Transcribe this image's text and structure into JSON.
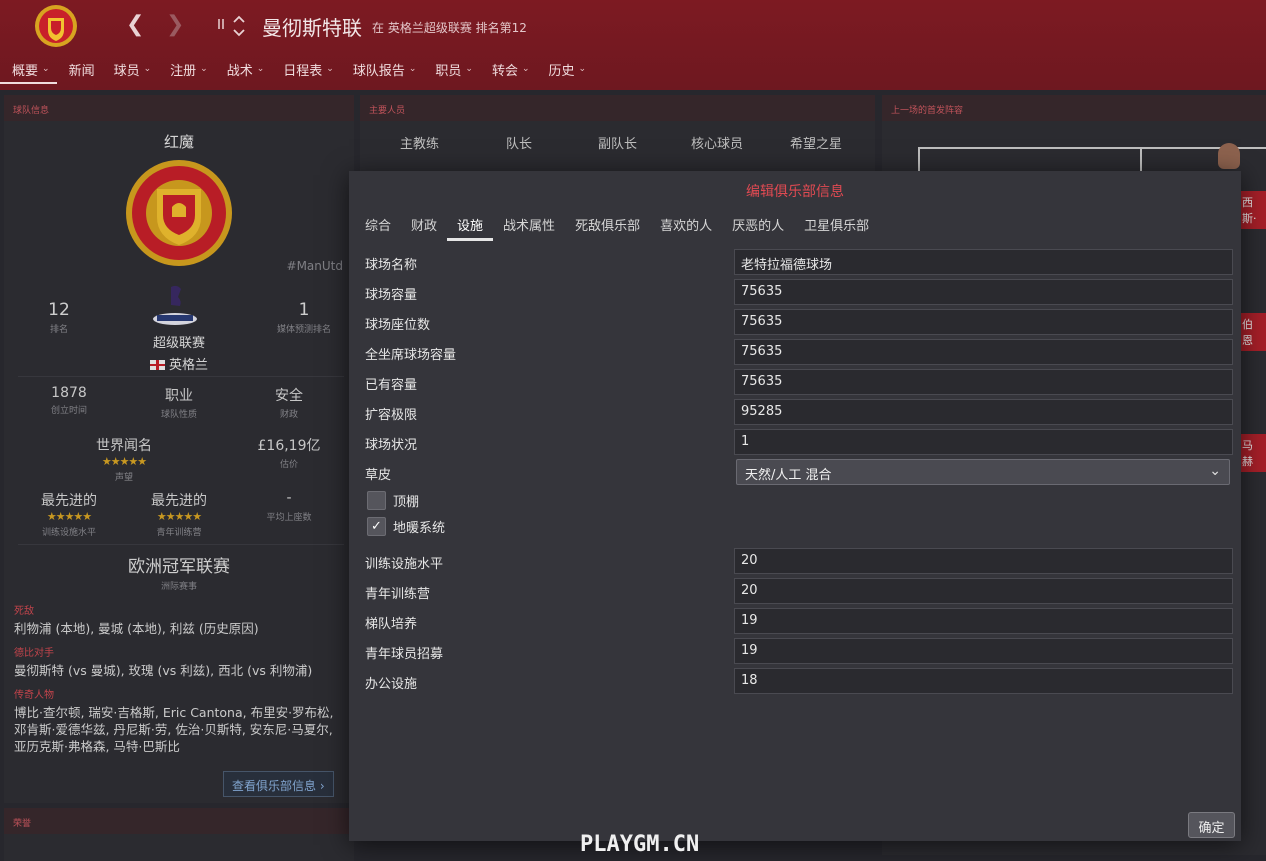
{
  "header": {
    "club_name": "曼彻斯特联",
    "club_subtitle": "在 英格兰超级联赛 排名第12",
    "menu": [
      {
        "label": "概要",
        "chevron": true,
        "active": true
      },
      {
        "label": "新闻",
        "chevron": false
      },
      {
        "label": "球员",
        "chevron": true
      },
      {
        "label": "注册",
        "chevron": true
      },
      {
        "label": "战术",
        "chevron": true
      },
      {
        "label": "日程表",
        "chevron": true
      },
      {
        "label": "球队报告",
        "chevron": true
      },
      {
        "label": "职员",
        "chevron": true
      },
      {
        "label": "转会",
        "chevron": true
      },
      {
        "label": "历史",
        "chevron": true
      }
    ]
  },
  "club_info": {
    "heading": "球队信息",
    "nickname": "红魔",
    "hashtag": "#ManUtd",
    "rank_value": "12",
    "rank_label": "排名",
    "league_name": "超级联赛",
    "league_country": "英格兰",
    "media_pred_value": "1",
    "media_pred_label": "媒体预测排名",
    "founded_value": "1878",
    "founded_label": "创立时间",
    "status_value": "职业",
    "status_label": "球队性质",
    "finance_value": "安全",
    "finance_label": "财政",
    "reputation_value": "世界闻名",
    "reputation_stars": "★★★★★",
    "reputation_label": "声望",
    "worth_value": "£16,19亿",
    "worth_label": "估价",
    "training_value": "最先进的",
    "training_stars": "★★★★★",
    "training_label": "训练设施水平",
    "youth_value": "最先进的",
    "youth_stars": "★★★★★",
    "youth_label": "青年训练营",
    "attendance_value": "-",
    "attendance_label": "平均上座数",
    "continental_value": "欧洲冠军联赛",
    "continental_label": "洲际赛事",
    "rivals_tag": "死敌",
    "rivals_text": "利物浦 (本地), 曼城 (本地), 利兹 (历史原因)",
    "derby_tag": "德比对手",
    "derby_text": "曼彻斯特 (vs 曼城), 玫瑰 (vs 利兹), 西北 (vs 利物浦)",
    "legends_tag": "传奇人物",
    "legends_text": "博比·查尔顿, 瑞安·吉格斯, Eric Cantona, 布里安·罗布松, 邓肯斯·爱德华兹, 丹尼斯·劳, 佐治·贝斯特, 安东尼·马夏尔, 亚历克斯·弗格森, 马特·巴斯比",
    "more_button": "查看俱乐部信息 ›"
  },
  "honours": {
    "heading": "荣誉"
  },
  "key_people": {
    "heading": "主要人员",
    "roles": [
      "主教练",
      "队长",
      "副队长",
      "核心球员",
      "希望之星"
    ]
  },
  "last_lineup": {
    "heading": "上一场的首发阵容",
    "visible_tags": [
      "西斯·",
      "伯恩",
      "马赫"
    ]
  },
  "modal": {
    "title": "编辑俱乐部信息",
    "tabs": [
      "综合",
      "财政",
      "设施",
      "战术属性",
      "死敌俱乐部",
      "喜欢的人",
      "厌恶的人",
      "卫星俱乐部"
    ],
    "active_tab": "设施",
    "fields_top": [
      {
        "label": "球场名称",
        "value": "老特拉福德球场"
      },
      {
        "label": "球场容量",
        "value": "75635"
      },
      {
        "label": "球场座位数",
        "value": "75635"
      },
      {
        "label": "全坐席球场容量",
        "value": "75635"
      },
      {
        "label": "已有容量",
        "value": "75635"
      },
      {
        "label": "扩容极限",
        "value": "95285"
      },
      {
        "label": "球场状况",
        "value": "1"
      }
    ],
    "turf_label": "草皮",
    "turf_value": "天然/人工 混合",
    "roof_label": "顶棚",
    "roof_checked": false,
    "heating_label": "地暖系统",
    "heating_checked": true,
    "fields_bottom": [
      {
        "label": "训练设施水平",
        "value": "20"
      },
      {
        "label": "青年训练营",
        "value": "20"
      },
      {
        "label": "梯队培养",
        "value": "19"
      },
      {
        "label": "青年球员招募",
        "value": "19"
      },
      {
        "label": "办公设施",
        "value": "18"
      }
    ],
    "ok_button": "确定"
  },
  "watermark": "PLAYGM.CN",
  "colors": {
    "header_bg": "#7d1a22",
    "accent_red": "#e04a52",
    "panel_bg": "#2f2f35",
    "modal_bg": "#35353b",
    "star_gold": "#d9a524"
  }
}
